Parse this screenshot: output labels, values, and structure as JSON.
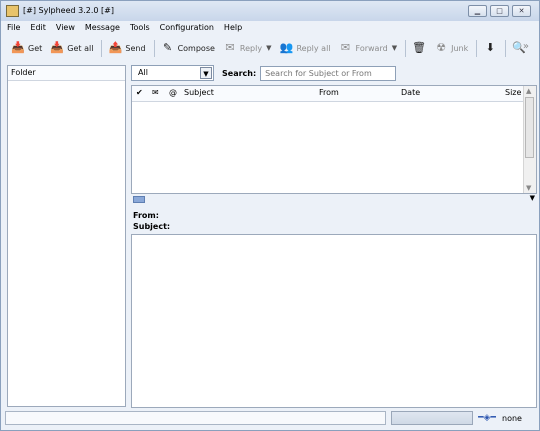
{
  "window": {
    "title": "[#] Sylpheed 3.2.0 [#]"
  },
  "menubar": [
    "File",
    "Edit",
    "View",
    "Message",
    "Tools",
    "Configuration",
    "Help"
  ],
  "toolbar": {
    "get": "Get",
    "get_all": "Get all",
    "send": "Send",
    "compose": "Compose",
    "reply": "Reply",
    "reply_all": "Reply all",
    "forward": "Forward",
    "junk": "Junk",
    "more": "»"
  },
  "folder": {
    "header": "Folder"
  },
  "filter": {
    "selected": "All",
    "search_label": "Search:",
    "search_placeholder": "Search for Subject or From"
  },
  "list": {
    "columns": [
      "✔",
      "✉",
      "@",
      "Subject",
      "From",
      "Date",
      "Size"
    ]
  },
  "message": {
    "from_label": "From:",
    "subject_label": "Subject:"
  },
  "status": {
    "online": "none"
  }
}
